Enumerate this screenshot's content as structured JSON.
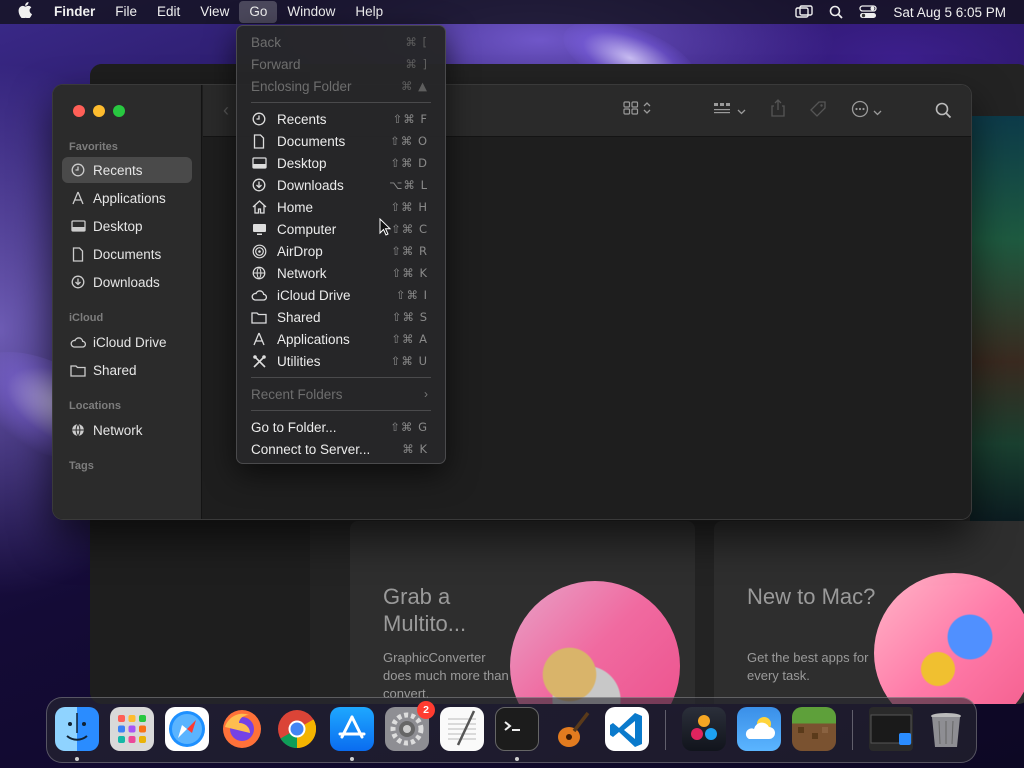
{
  "menubar": {
    "app_name": "Finder",
    "items": [
      "File",
      "Edit",
      "View",
      "Go",
      "Window",
      "Help"
    ],
    "active_item": "Go",
    "clock": "Sat Aug 5  6:05 PM"
  },
  "finder": {
    "sidebar": {
      "favorites_heading": "Favorites",
      "favorites": [
        {
          "label": "Recents",
          "icon": "clock-icon",
          "selected": true
        },
        {
          "label": "Applications",
          "icon": "applications-icon"
        },
        {
          "label": "Desktop",
          "icon": "desktop-icon"
        },
        {
          "label": "Documents",
          "icon": "document-icon"
        },
        {
          "label": "Downloads",
          "icon": "download-icon"
        }
      ],
      "icloud_heading": "iCloud",
      "icloud": [
        {
          "label": "iCloud Drive",
          "icon": "cloud-icon"
        },
        {
          "label": "Shared",
          "icon": "shared-folder-icon"
        }
      ],
      "locations_heading": "Locations",
      "locations": [
        {
          "label": "Network",
          "icon": "globe-icon"
        }
      ],
      "tags_heading": "Tags"
    }
  },
  "go_menu": {
    "top": [
      {
        "label": "Back",
        "shortcut": "⌘ [",
        "disabled": true
      },
      {
        "label": "Forward",
        "shortcut": "⌘ ]",
        "disabled": true
      },
      {
        "label": "Enclosing Folder",
        "shortcut": "⌘ ▲",
        "disabled": true
      }
    ],
    "places": [
      {
        "label": "Recents",
        "shortcut": "⇧⌘ F",
        "icon": "clock-icon"
      },
      {
        "label": "Documents",
        "shortcut": "⇧⌘ O",
        "icon": "document-icon"
      },
      {
        "label": "Desktop",
        "shortcut": "⇧⌘ D",
        "icon": "desktop-icon"
      },
      {
        "label": "Downloads",
        "shortcut": "⌥⌘ L",
        "icon": "download-icon"
      },
      {
        "label": "Home",
        "shortcut": "⇧⌘ H",
        "icon": "home-icon"
      },
      {
        "label": "Computer",
        "shortcut": "⇧⌘ C",
        "icon": "computer-icon"
      },
      {
        "label": "AirDrop",
        "shortcut": "⇧⌘ R",
        "icon": "airdrop-icon"
      },
      {
        "label": "Network",
        "shortcut": "⇧⌘ K",
        "icon": "globe-icon"
      },
      {
        "label": "iCloud Drive",
        "shortcut": "⇧⌘ I",
        "icon": "cloud-icon"
      },
      {
        "label": "Shared",
        "shortcut": "⇧⌘ S",
        "icon": "shared-folder-icon"
      },
      {
        "label": "Applications",
        "shortcut": "⇧⌘ A",
        "icon": "applications-icon"
      },
      {
        "label": "Utilities",
        "shortcut": "⇧⌘ U",
        "icon": "utilities-icon"
      }
    ],
    "recent_folders": "Recent Folders",
    "go_to_folder": {
      "label": "Go to Folder...",
      "shortcut": "⇧⌘ G"
    },
    "connect_to_server": {
      "label": "Connect to Server...",
      "shortcut": "⌘ K"
    }
  },
  "background_app": {
    "card1": {
      "title": "Grab a Multito...",
      "text": "GraphicConverter does much more than convert."
    },
    "card2": {
      "title": "New to Mac?",
      "text": "Get the best apps for every task."
    }
  },
  "dock": {
    "apps": [
      "Finder",
      "Launchpad",
      "Safari",
      "Firefox",
      "Chrome",
      "App Store",
      "System Settings",
      "TextEdit",
      "Terminal",
      "GarageBand",
      "Visual Studio Code",
      "DaVinci Resolve",
      "Weather",
      "Minecraft",
      "Screenshot",
      "Trash"
    ],
    "settings_badge": "2"
  }
}
